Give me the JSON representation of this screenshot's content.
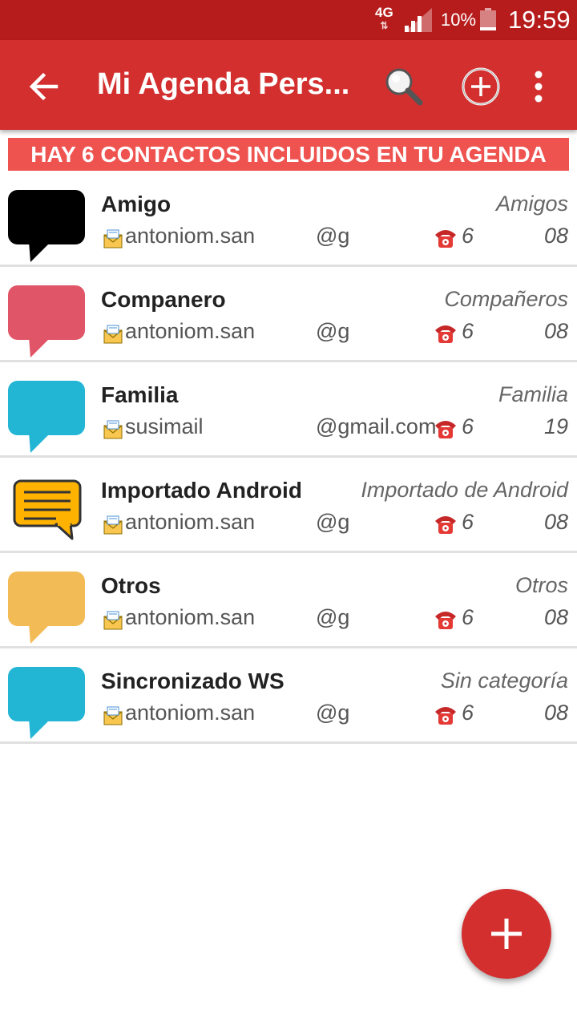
{
  "status_bar": {
    "network": "4G",
    "battery": "10%",
    "time": "19:59"
  },
  "toolbar": {
    "title": "Mi Agenda Pers..."
  },
  "banner": {
    "text": "HAY 6 CONTACTOS INCLUIDOS EN TU AGENDA"
  },
  "contacts": [
    {
      "name": "Amigo",
      "category": "Amigos",
      "email_start": "antoniom.san",
      "email_end": "@g",
      "phone_start": "6",
      "phone_end": "08",
      "bubble_color": "#000000",
      "bubble_icon": "speech-bubble-icon"
    },
    {
      "name": "Companero",
      "category": "Compañeros",
      "email_start": "antoniom.san",
      "email_end": "@g",
      "phone_start": "6",
      "phone_end": "08",
      "bubble_color": "#e05567",
      "bubble_icon": "speech-bubble-icon"
    },
    {
      "name": "Familia",
      "category": "Familia",
      "email_start": "susimail",
      "email_end": "@gmail.com",
      "phone_start": "6",
      "phone_end": "19",
      "bubble_color": "#22b5d4",
      "bubble_icon": "speech-bubble-icon"
    },
    {
      "name": "Importado Android",
      "category": "Importado de Android",
      "email_start": "antoniom.san",
      "email_end": "@g",
      "phone_start": "6",
      "phone_end": "08",
      "bubble_color": "#ffb300",
      "bubble_icon": "message-lines-icon"
    },
    {
      "name": "Otros",
      "category": "Otros",
      "email_start": "antoniom.san",
      "email_end": "@g",
      "phone_start": "6",
      "phone_end": "08",
      "bubble_color": "#f2bb55",
      "bubble_icon": "speech-bubble-icon"
    },
    {
      "name": "Sincronizado WS",
      "category": "Sin categoría",
      "email_start": "antoniom.san",
      "email_end": "@g",
      "phone_start": "6",
      "phone_end": "08",
      "bubble_color": "#22b5d4",
      "bubble_icon": "speech-bubble-icon"
    }
  ],
  "fab": {
    "icon": "plus-icon"
  },
  "colors": {
    "status_bar": "#b71c1c",
    "app_bar": "#d32f2f",
    "banner": "#ef5350"
  }
}
